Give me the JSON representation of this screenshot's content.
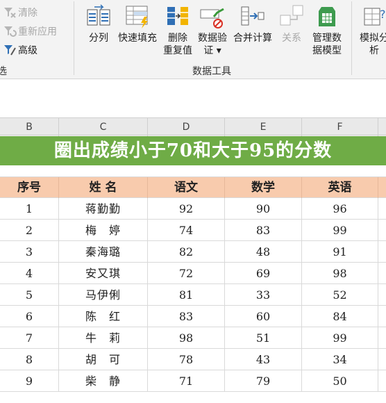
{
  "ribbon": {
    "sort_filter": {
      "clear_label": "清除",
      "reapply_label": "重新应用",
      "advanced_label": "高级",
      "group_label": "选"
    },
    "data_tools": {
      "split_label": "分列",
      "flash_fill_label": "快速填充",
      "remove_dup_line1": "删除",
      "remove_dup_line2": "重复值",
      "validation_line1": "数据验",
      "validation_line2": "证 ▾",
      "consolidate_label": "合并计算",
      "relations_label": "关系",
      "model_line1": "管理数",
      "model_line2": "据模型",
      "group_label": "数据工具"
    },
    "forecast": {
      "whatif_line1": "模拟分",
      "whatif_line2": "析"
    }
  },
  "columns": [
    "B",
    "C",
    "D",
    "E",
    "F"
  ],
  "title": "圈出成绩小于70和大于95的分数",
  "table": {
    "headers": [
      "序号",
      "姓 名",
      "语文",
      "数学",
      "英语"
    ],
    "rows": [
      [
        "1",
        "蒋勤勤",
        "92",
        "90",
        "96"
      ],
      [
        "2",
        "梅　婷",
        "74",
        "83",
        "99"
      ],
      [
        "3",
        "秦海璐",
        "82",
        "48",
        "91"
      ],
      [
        "4",
        "安又琪",
        "72",
        "69",
        "98"
      ],
      [
        "5",
        "马伊俐",
        "81",
        "33",
        "52"
      ],
      [
        "6",
        "陈　红",
        "83",
        "60",
        "84"
      ],
      [
        "7",
        "牛　莉",
        "98",
        "51",
        "99"
      ],
      [
        "8",
        "胡　可",
        "78",
        "43",
        "34"
      ],
      [
        "9",
        "柴　静",
        "71",
        "79",
        "50"
      ]
    ]
  },
  "colors": {
    "title_bg": "#6fac46",
    "header_bg": "#f8cbad",
    "ribbon_bg": "#f3f3f3"
  }
}
